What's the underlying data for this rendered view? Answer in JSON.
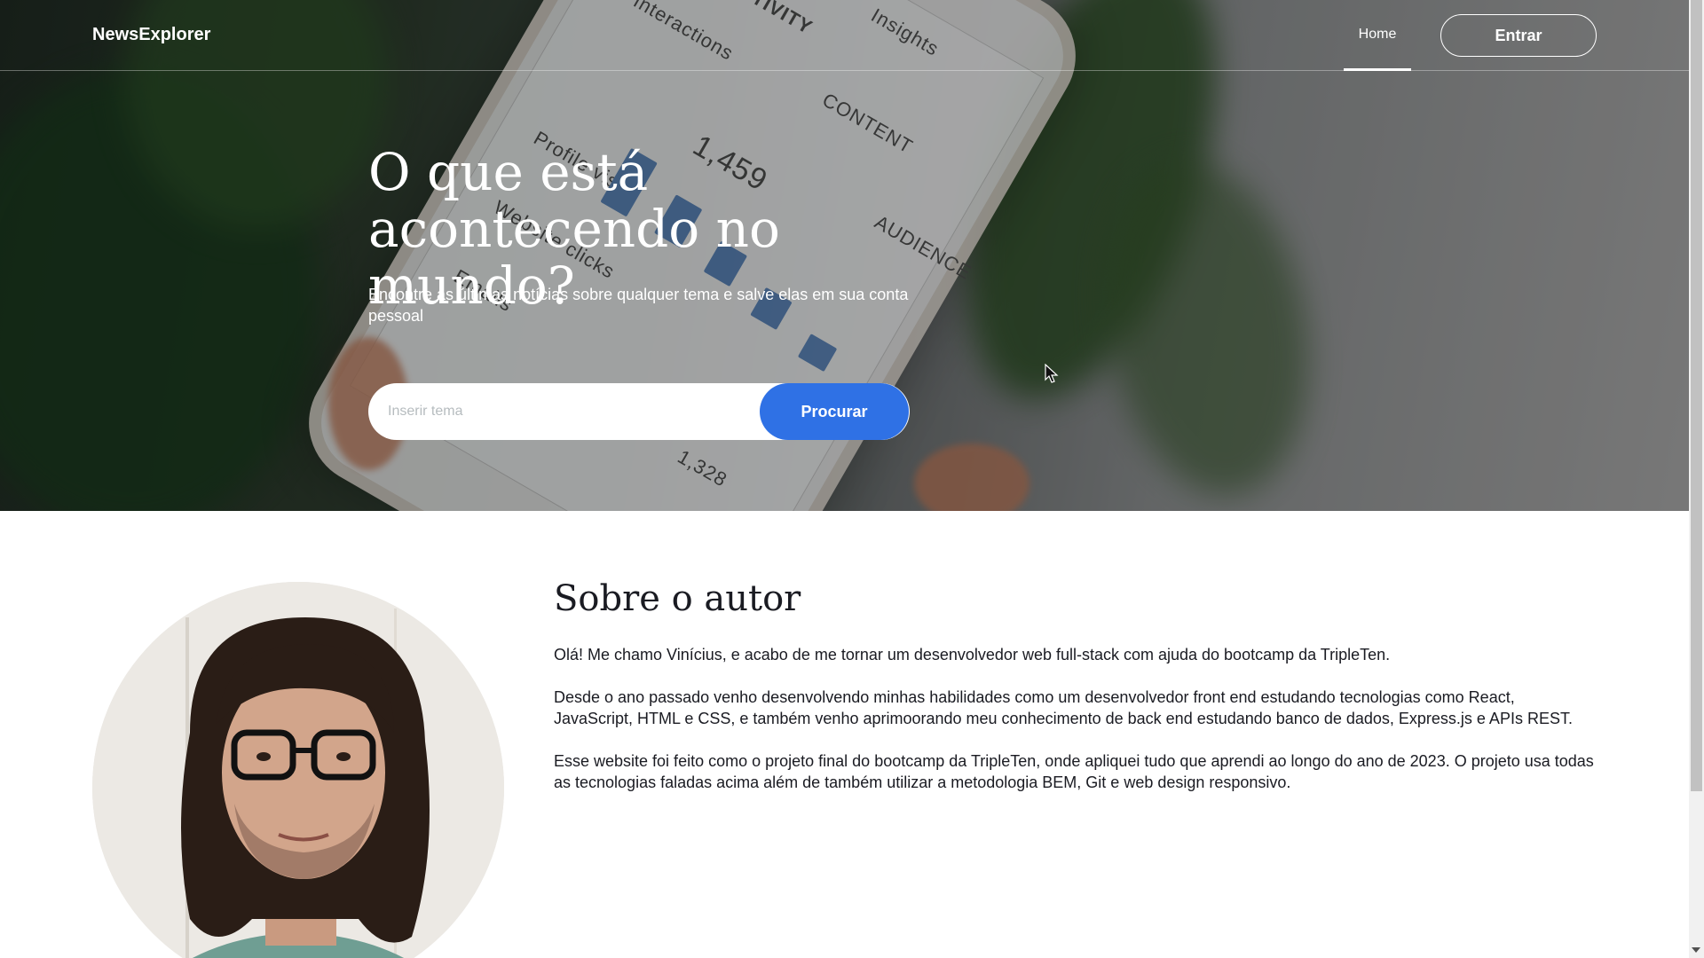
{
  "header": {
    "logo": "NewsExplorer",
    "nav_home": "Home",
    "login_button": "Entrar"
  },
  "hero": {
    "title": "O que está acontecendo no mundo?",
    "subtitle": "Encontre as últimas notícias sobre qualquer tema e salve elas em sua conta pessoal",
    "search": {
      "placeholder": "Inserir tema",
      "value": "",
      "button_label": "Procurar"
    },
    "phone_labels": [
      "Insights",
      "ACTIVITY",
      "Interactions",
      "CONTENT",
      "AUDIENCE",
      "1,459",
      "Profile visits",
      "Website clicks",
      "Emails",
      "1,328"
    ]
  },
  "about": {
    "title": "Sobre o autor",
    "paragraphs": [
      "Olá! Me chamo Vinícius, e acabo de me tornar um desenvolvedor web full-stack com ajuda do bootcamp da TripleTen.",
      "Desde o ano passado venho desenvolvendo minhas habilidades como um desenvolvedor front end estudando tecnologias como React, JavaScript, HTML e CSS, e também venho aprimoorando meu conhecimento de back end estudando banco de dados, Express.js e APIs REST.",
      "Esse website foi feito como o projeto final do bootcamp da TripleTen, onde apliquei tudo que aprendi ao longo do ano de 2023. O projeto usa todas as tecnologias faladas acima além de também utilizar a metodologia BEM, Git e web design responsivo."
    ]
  },
  "colors": {
    "accent": "#2f71e5",
    "text_dark": "#1a1b22",
    "white": "#ffffff"
  }
}
